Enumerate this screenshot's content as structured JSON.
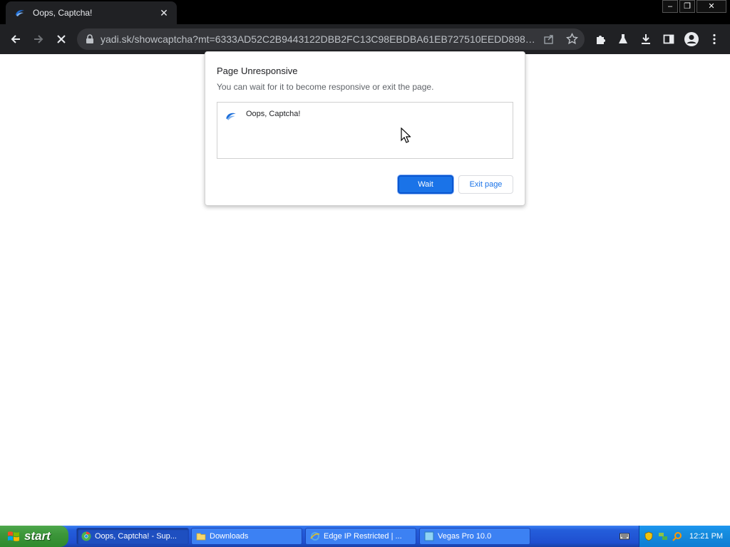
{
  "browser": {
    "tab": {
      "title": "Oops, Captcha!",
      "favicon": "yandex-disk-icon",
      "close_glyph": "✕"
    },
    "window_controls": {
      "minimize": "–",
      "restore": "❐",
      "close": "✕"
    },
    "toolbar": {
      "back_icon": "back-arrow-icon",
      "forward_icon": "forward-arrow-icon",
      "stop_icon": "stop-icon",
      "url": "yadi.sk/showcaptcha?mt=6333AD52C2B9443122DBB2FC13C98EBDBA61EB727510EEDD89897...",
      "share_icon": "share-icon",
      "bookmark_icon": "star-icon",
      "extensions_icon": "puzzle-icon",
      "labs_icon": "flask-icon",
      "download_icon": "download-icon",
      "sidepanel_icon": "side-panel-icon",
      "profile_icon": "profile-icon",
      "menu_icon": "kebab-menu-icon"
    }
  },
  "dialog": {
    "title": "Page Unresponsive",
    "message": "You can wait for it to become responsive or exit the page.",
    "pages": [
      {
        "label": "Oops, Captcha!",
        "icon": "yandex-disk-icon"
      }
    ],
    "wait_label": "Wait",
    "exit_label": "Exit page"
  },
  "taskbar": {
    "start_label": "start",
    "tasks": [
      {
        "label": "Oops, Captcha! - Sup...",
        "icon": "chrome-icon",
        "active": true
      },
      {
        "label": "Downloads",
        "icon": "folder-icon",
        "active": false
      },
      {
        "label": "Edge IP Restricted | ...",
        "icon": "ie-icon",
        "active": false
      },
      {
        "label": "Vegas Pro 10.0",
        "icon": "vegas-icon",
        "active": false
      }
    ],
    "clock": "12:21 PM"
  },
  "colors": {
    "accent": "#1a73e8",
    "toolbar_bg": "#202124",
    "taskbar_blue": "#245edb",
    "start_green": "#3c963a"
  }
}
